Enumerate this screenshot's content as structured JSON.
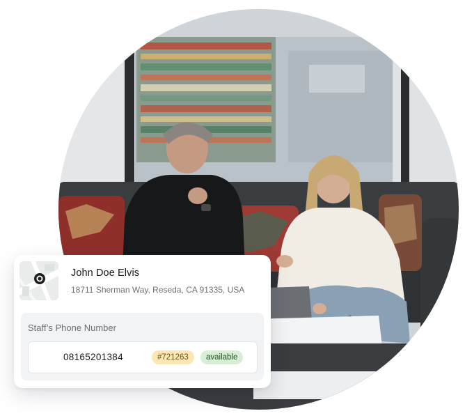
{
  "contact": {
    "name": "John Doe Elvis",
    "address": "18711 Sherman Way, Reseda, CA 91335, USA"
  },
  "phone": {
    "label": "Staff’s Phone Number",
    "number": "08165201384",
    "id_badge": "#721263",
    "status_badge": "available"
  },
  "colors": {
    "id_badge_bg": "#fde8b4",
    "status_badge_bg": "#d7f0d5",
    "panel_bg": "#f2f3f5"
  },
  "icons": {
    "map_pin": "map-pin-icon"
  }
}
